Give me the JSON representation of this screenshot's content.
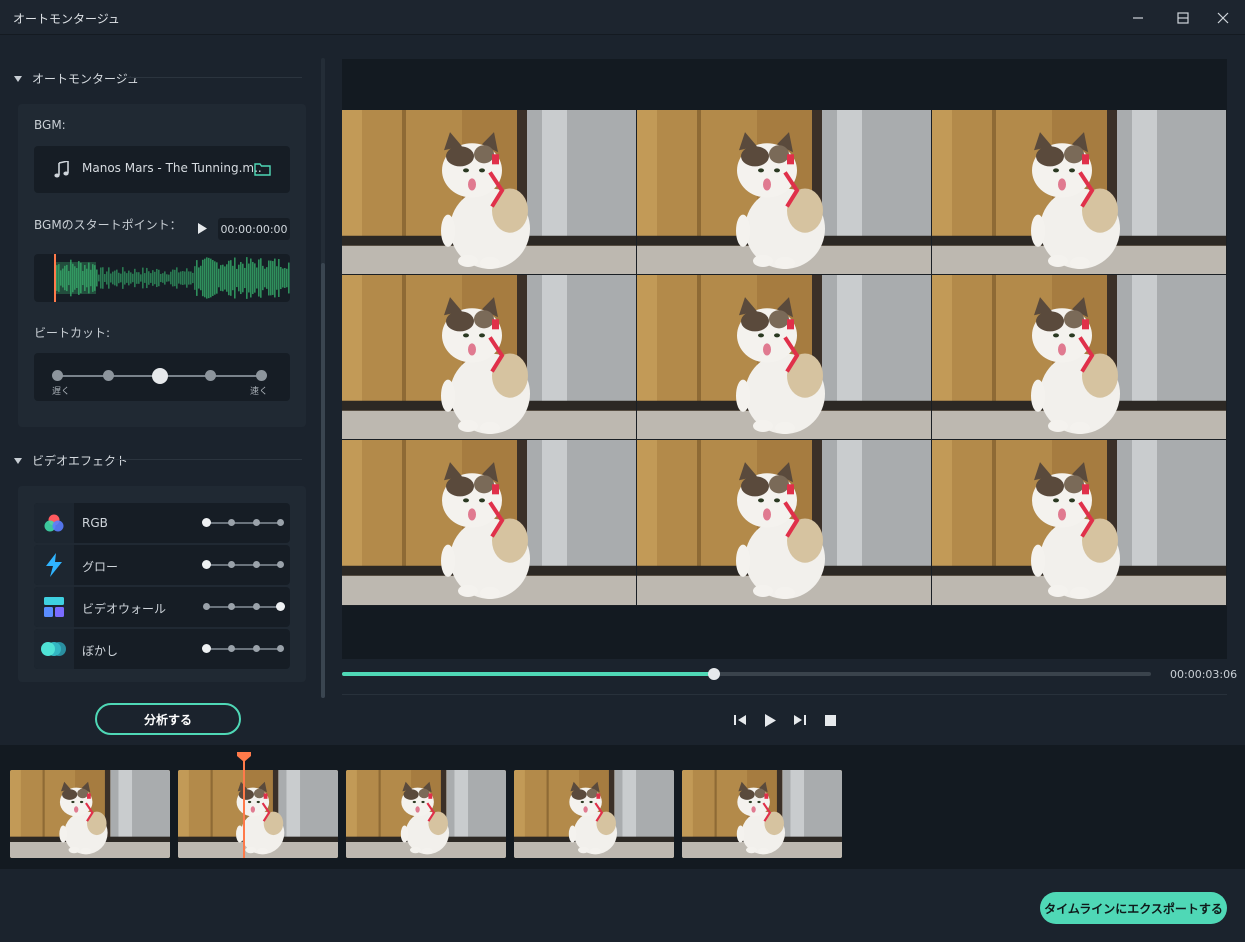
{
  "window": {
    "title": "オートモンタージュ"
  },
  "sections": {
    "auto_montage": {
      "title": "オートモンタージュ"
    },
    "video_effect": {
      "title": "ビデオエフェクト"
    }
  },
  "bgm": {
    "label": "BGM:",
    "file_name": "Manos Mars - The Tunning.m..",
    "start_point_label": "BGMのスタートポイント：",
    "start_time": "00:00:00:00"
  },
  "beat_cut": {
    "label": "ビートカット:",
    "slow_label": "遅く",
    "fast_label": "速く",
    "level": 3,
    "levels": 5
  },
  "effects": [
    {
      "name": "RGB",
      "level": 1
    },
    {
      "name": "グロー",
      "level": 1
    },
    {
      "name": "ビデオウォール",
      "level": 4
    },
    {
      "name": "ぼかし",
      "level": 1
    }
  ],
  "analyze_button": "分析する",
  "player": {
    "total_time": "00:00:03:06",
    "progress": 0.46
  },
  "export_button": "タイムラインにエクスポートする",
  "colors": {
    "accent": "#4fd8b6",
    "playhead": "#ff7a4a",
    "background": "#1b232d"
  }
}
